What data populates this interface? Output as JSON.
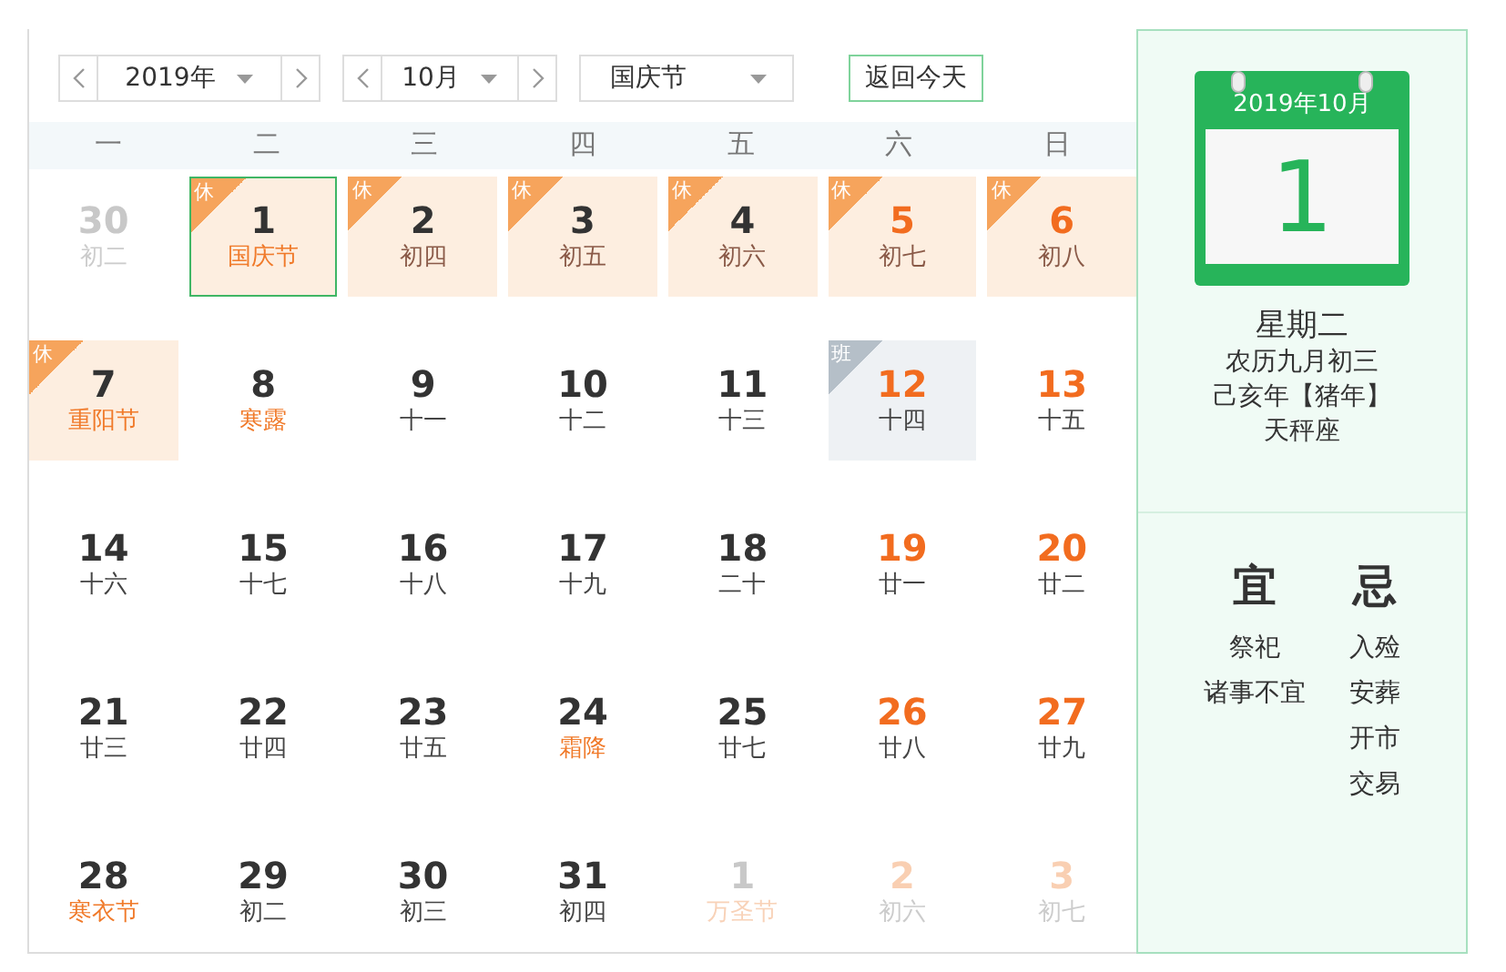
{
  "year_picker": {
    "value": "2019年"
  },
  "month_picker": {
    "value": "10月"
  },
  "holiday_picker": {
    "value": "国庆节"
  },
  "today_button": "返回今天",
  "weekdays": [
    "一",
    "二",
    "三",
    "四",
    "五",
    "六",
    "日"
  ],
  "days": [
    {
      "day": "30",
      "lunar": "初二",
      "in_month": false,
      "weekend": false,
      "festival": false,
      "selected": false
    },
    {
      "day": "1",
      "lunar": "国庆节",
      "in_month": true,
      "weekend": false,
      "festival": true,
      "selected": true,
      "tag": {
        "text": "休",
        "kind": "rest"
      }
    },
    {
      "day": "2",
      "lunar": "初四",
      "in_month": true,
      "weekend": false,
      "festival": false,
      "selected": false,
      "tag": {
        "text": "休",
        "kind": "rest"
      }
    },
    {
      "day": "3",
      "lunar": "初五",
      "in_month": true,
      "weekend": false,
      "festival": false,
      "selected": false,
      "tag": {
        "text": "休",
        "kind": "rest"
      }
    },
    {
      "day": "4",
      "lunar": "初六",
      "in_month": true,
      "weekend": false,
      "festival": false,
      "selected": false,
      "tag": {
        "text": "休",
        "kind": "rest"
      }
    },
    {
      "day": "5",
      "lunar": "初七",
      "in_month": true,
      "weekend": true,
      "festival": false,
      "selected": false,
      "tag": {
        "text": "休",
        "kind": "rest"
      }
    },
    {
      "day": "6",
      "lunar": "初八",
      "in_month": true,
      "weekend": true,
      "festival": false,
      "selected": false,
      "tag": {
        "text": "休",
        "kind": "rest"
      }
    },
    {
      "day": "7",
      "lunar": "重阳节",
      "in_month": true,
      "weekend": false,
      "festival": true,
      "selected": false,
      "tag": {
        "text": "休",
        "kind": "rest"
      }
    },
    {
      "day": "8",
      "lunar": "寒露",
      "in_month": true,
      "weekend": false,
      "festival": true,
      "selected": false
    },
    {
      "day": "9",
      "lunar": "十一",
      "in_month": true,
      "weekend": false,
      "festival": false,
      "selected": false
    },
    {
      "day": "10",
      "lunar": "十二",
      "in_month": true,
      "weekend": false,
      "festival": false,
      "selected": false
    },
    {
      "day": "11",
      "lunar": "十三",
      "in_month": true,
      "weekend": false,
      "festival": false,
      "selected": false
    },
    {
      "day": "12",
      "lunar": "十四",
      "in_month": true,
      "weekend": true,
      "festival": false,
      "selected": false,
      "tag": {
        "text": "班",
        "kind": "work"
      }
    },
    {
      "day": "13",
      "lunar": "十五",
      "in_month": true,
      "weekend": true,
      "festival": false,
      "selected": false
    },
    {
      "day": "14",
      "lunar": "十六",
      "in_month": true,
      "weekend": false,
      "festival": false,
      "selected": false
    },
    {
      "day": "15",
      "lunar": "十七",
      "in_month": true,
      "weekend": false,
      "festival": false,
      "selected": false
    },
    {
      "day": "16",
      "lunar": "十八",
      "in_month": true,
      "weekend": false,
      "festival": false,
      "selected": false
    },
    {
      "day": "17",
      "lunar": "十九",
      "in_month": true,
      "weekend": false,
      "festival": false,
      "selected": false
    },
    {
      "day": "18",
      "lunar": "二十",
      "in_month": true,
      "weekend": false,
      "festival": false,
      "selected": false
    },
    {
      "day": "19",
      "lunar": "廿一",
      "in_month": true,
      "weekend": true,
      "festival": false,
      "selected": false
    },
    {
      "day": "20",
      "lunar": "廿二",
      "in_month": true,
      "weekend": true,
      "festival": false,
      "selected": false
    },
    {
      "day": "21",
      "lunar": "廿三",
      "in_month": true,
      "weekend": false,
      "festival": false,
      "selected": false
    },
    {
      "day": "22",
      "lunar": "廿四",
      "in_month": true,
      "weekend": false,
      "festival": false,
      "selected": false
    },
    {
      "day": "23",
      "lunar": "廿五",
      "in_month": true,
      "weekend": false,
      "festival": false,
      "selected": false
    },
    {
      "day": "24",
      "lunar": "霜降",
      "in_month": true,
      "weekend": false,
      "festival": true,
      "selected": false
    },
    {
      "day": "25",
      "lunar": "廿七",
      "in_month": true,
      "weekend": false,
      "festival": false,
      "selected": false
    },
    {
      "day": "26",
      "lunar": "廿八",
      "in_month": true,
      "weekend": true,
      "festival": false,
      "selected": false
    },
    {
      "day": "27",
      "lunar": "廿九",
      "in_month": true,
      "weekend": true,
      "festival": false,
      "selected": false
    },
    {
      "day": "28",
      "lunar": "寒衣节",
      "in_month": true,
      "weekend": false,
      "festival": true,
      "selected": false
    },
    {
      "day": "29",
      "lunar": "初二",
      "in_month": true,
      "weekend": false,
      "festival": false,
      "selected": false
    },
    {
      "day": "30",
      "lunar": "初三",
      "in_month": true,
      "weekend": false,
      "festival": false,
      "selected": false
    },
    {
      "day": "31",
      "lunar": "初四",
      "in_month": true,
      "weekend": false,
      "festival": false,
      "selected": false
    },
    {
      "day": "1",
      "lunar": "万圣节",
      "in_month": false,
      "weekend": false,
      "festival": true,
      "selected": false
    },
    {
      "day": "2",
      "lunar": "初六",
      "in_month": false,
      "weekend": true,
      "festival": false,
      "selected": false
    },
    {
      "day": "3",
      "lunar": "初七",
      "in_month": false,
      "weekend": true,
      "festival": false,
      "selected": false
    }
  ],
  "detail": {
    "month": "2019年10月",
    "day": "1",
    "weekday": "星期二",
    "lunar": "农历九月初三",
    "ganzhi": "己亥年【猪年】",
    "zodiac": "天秤座",
    "good": {
      "title": "宜",
      "items": [
        "祭祀",
        "诸事不宜"
      ]
    },
    "bad": {
      "title": "忌",
      "items": [
        "入殓",
        "安葬",
        "开市",
        "交易"
      ]
    }
  }
}
